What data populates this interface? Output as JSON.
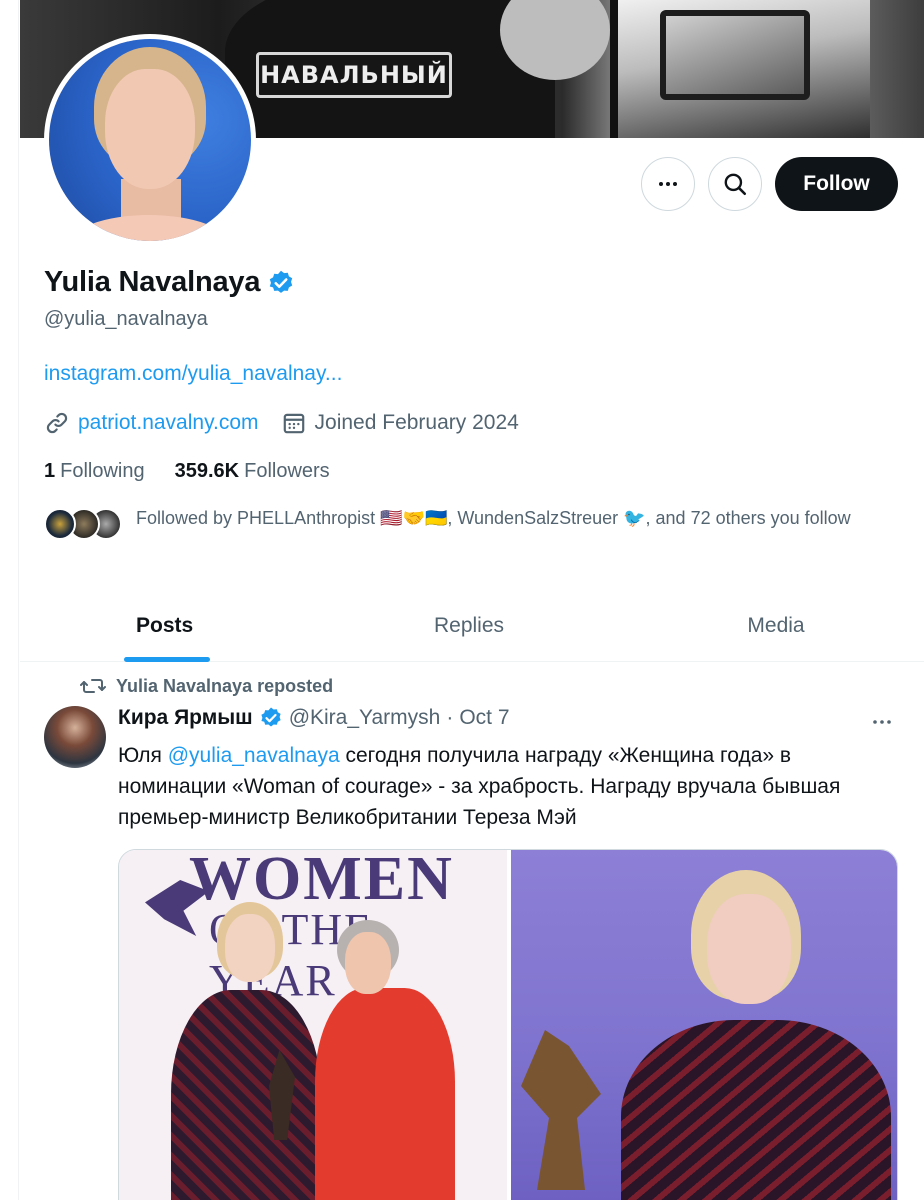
{
  "banner": {
    "patch_text": "НАВАЛЬНЫЙ"
  },
  "profile": {
    "name": "Yulia Navalnaya",
    "handle": "@yulia_navalnaya",
    "bio_link": "instagram.com/yulia_navalnay...",
    "website": "patriot.navalny.com",
    "joined": "Joined February 2024",
    "following_count": "1",
    "following_label": "Following",
    "followers_count": "359.6K",
    "followers_label": "Followers",
    "followed_by_text": "Followed by PHELLAnthropist 🇺🇸🤝🇺🇦, WundenSalzStreuer 🐦, and 72 others you follow",
    "verified_icon": "verified-badge-icon",
    "website_icon": "link-icon",
    "joined_icon": "calendar-icon"
  },
  "actions": {
    "more_icon": "more-horizontal-icon",
    "search_icon": "search-icon",
    "follow_label": "Follow"
  },
  "tabs": [
    {
      "label": "Posts",
      "active": true
    },
    {
      "label": "Replies",
      "active": false
    },
    {
      "label": "Media",
      "active": false
    }
  ],
  "tweet": {
    "repost_text": "Yulia Navalnaya reposted",
    "author_name": "Кира Ярмыш",
    "author_handle": "@Kira_Yarmysh",
    "separator": "·",
    "date": "Oct 7",
    "text_before": "Юля ",
    "mention": "@yulia_navalnaya",
    "text_after": " сегодня получила награду «Женщина года» в номинации «Woman of courage» - за храбрость. Награду вручала бывшая премьер-министр Великобритании Тереза Мэй",
    "media": {
      "left_title_1": "WOMEN",
      "left_title_2": "OF THE YEAR"
    }
  },
  "colors": {
    "accent": "#1d9bf0",
    "text_primary": "#0f1419",
    "text_secondary": "#536471",
    "follow_button_bg": "#0f1419",
    "border": "#cfd9de"
  }
}
